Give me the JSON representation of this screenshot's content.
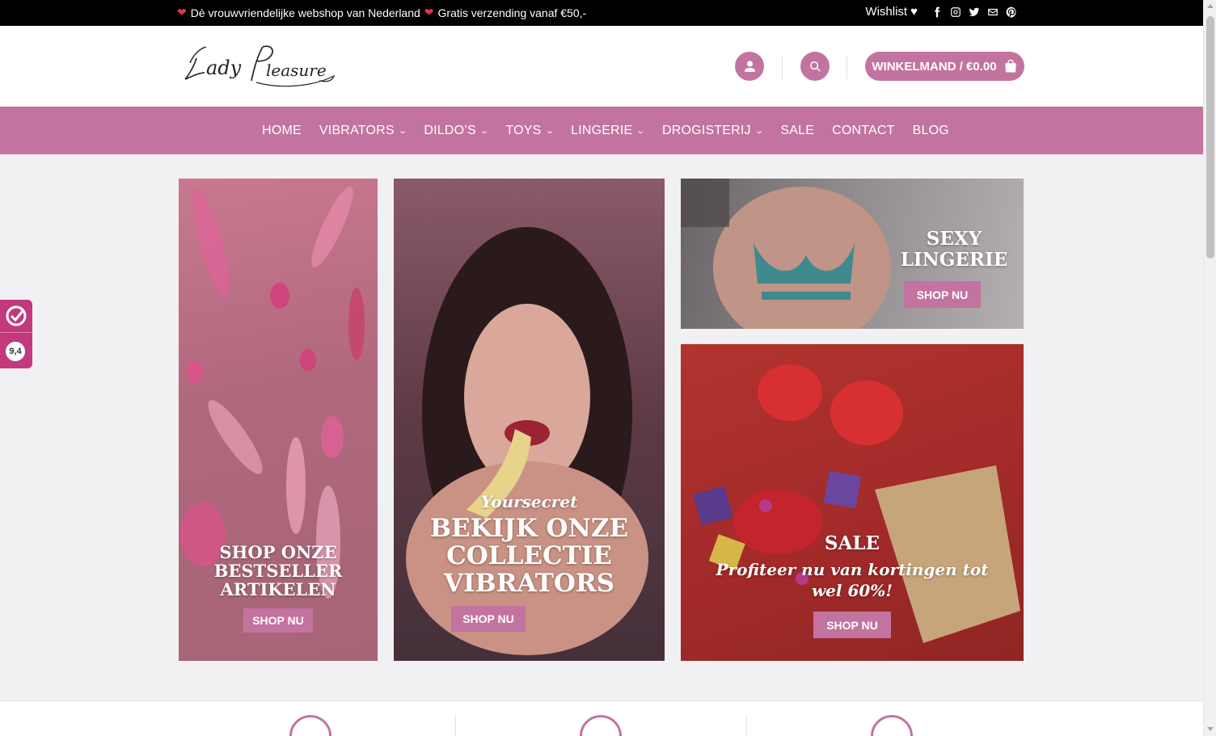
{
  "topbar": {
    "tagline_1": "Dè vrouwvriendelijke webshop van Nederland",
    "tagline_2": "Gratis verzending vanaf €50,-",
    "wishlist_label": "Wishlist",
    "social_icons": [
      "facebook-icon",
      "instagram-icon",
      "twitter-icon",
      "email-icon",
      "pinterest-icon"
    ]
  },
  "header": {
    "logo_text": "Lady Pleasure",
    "cart_label": "WINKELMAND / €0.00"
  },
  "nav": {
    "items": [
      {
        "label": "HOME",
        "dropdown": false
      },
      {
        "label": "VIBRATORS",
        "dropdown": true
      },
      {
        "label": "DILDO’S",
        "dropdown": true
      },
      {
        "label": "TOYS",
        "dropdown": true
      },
      {
        "label": "LINGERIE",
        "dropdown": true
      },
      {
        "label": "DROGISTERIJ",
        "dropdown": true
      },
      {
        "label": "SALE",
        "dropdown": false
      },
      {
        "label": "CONTACT",
        "dropdown": false
      },
      {
        "label": "BLOG",
        "dropdown": false
      }
    ]
  },
  "banners": {
    "bestseller": {
      "line1": "SHOP ONZE",
      "line2": "BESTSELLER",
      "line3": "ARTIKELEN",
      "button": "SHOP NU"
    },
    "vibrators": {
      "script": "Yoursecret",
      "line1": "BEKIJK ONZE",
      "line2": "COLLECTIE",
      "line3": "VIBRATORS",
      "button": "SHOP NU"
    },
    "lingerie": {
      "line1": "SEXY",
      "line2": "LINGERIE",
      "button": "SHOP NU"
    },
    "sale": {
      "title": "SALE",
      "sub1": "Profiteer nu van kortingen tot",
      "sub2": "wel 60%!",
      "button": "SHOP NU"
    }
  },
  "review_badge": {
    "score": "9,4"
  },
  "colors": {
    "accent": "#c3739f",
    "topbar": "#000000",
    "badge": "#c3397e"
  }
}
